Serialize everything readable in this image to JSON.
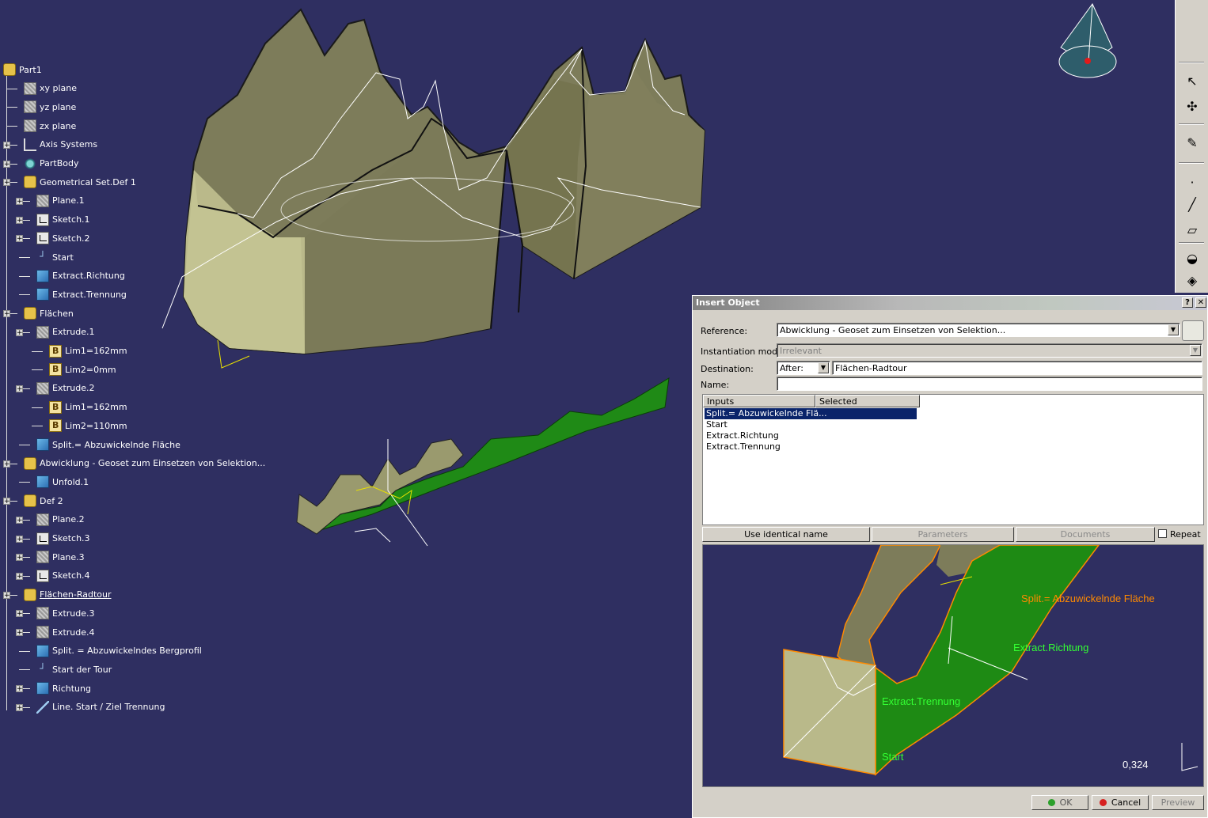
{
  "tree": [
    {
      "label": "Part1",
      "icon": "part-icon"
    },
    {
      "label": "xy plane",
      "icon": "plane-icon"
    },
    {
      "label": "yz plane",
      "icon": "plane-icon"
    },
    {
      "label": "zx plane",
      "icon": "plane-icon"
    },
    {
      "label": "Axis Systems",
      "icon": "axis-icon"
    },
    {
      "label": "PartBody",
      "icon": "body-icon"
    },
    {
      "label": "Geometrical Set.Def 1",
      "icon": "geoset-icon"
    },
    {
      "label": "Plane.1",
      "icon": "plane-icon"
    },
    {
      "label": "Sketch.1",
      "icon": "sketch-icon"
    },
    {
      "label": "Sketch.2",
      "icon": "sketch-icon"
    },
    {
      "label": "Start",
      "icon": "point-icon"
    },
    {
      "label": "Extract.Richtung",
      "icon": "surface-icon"
    },
    {
      "label": "Extract.Trennung",
      "icon": "surface-icon"
    },
    {
      "label": "Flächen",
      "icon": "geoset-icon"
    },
    {
      "label": "Extrude.1",
      "icon": "plane-icon"
    },
    {
      "label": "Lim1=162mm",
      "icon": "limit-icon"
    },
    {
      "label": "Lim2=0mm",
      "icon": "limit-icon"
    },
    {
      "label": "Extrude.2",
      "icon": "plane-icon"
    },
    {
      "label": "Lim1=162mm",
      "icon": "limit-icon"
    },
    {
      "label": "Lim2=110mm",
      "icon": "limit-icon"
    },
    {
      "label": "Split.= Abzuwickelnde Fläche",
      "icon": "surface-icon"
    },
    {
      "label": "Abwicklung - Geoset zum Einsetzen von Selektion...",
      "icon": "geoset-icon"
    },
    {
      "label": "Unfold.1",
      "icon": "surface-icon"
    },
    {
      "label": "Def 2",
      "icon": "geoset-icon"
    },
    {
      "label": "Plane.2",
      "icon": "plane-icon"
    },
    {
      "label": "Sketch.3",
      "icon": "sketch-icon"
    },
    {
      "label": "Plane.3",
      "icon": "plane-icon"
    },
    {
      "label": "Sketch.4",
      "icon": "sketch-icon"
    },
    {
      "label": "Flächen-Radtour",
      "icon": "geoset-icon"
    },
    {
      "label": "Extrude.3",
      "icon": "plane-icon"
    },
    {
      "label": "Extrude.4",
      "icon": "plane-icon"
    },
    {
      "label": "Split. = Abzuwickelndes Bergprofil",
      "icon": "surface-icon"
    },
    {
      "label": "Start der Tour",
      "icon": "point-icon"
    },
    {
      "label": "Richtung",
      "icon": "surface-icon"
    },
    {
      "label": "Line. Start / Ziel Trennung",
      "icon": "line-icon"
    }
  ],
  "dialog": {
    "title": "Insert Object",
    "help": "?",
    "close": "✕",
    "reference_label": "Reference:",
    "reference_value": "Abwicklung - Geoset zum Einsetzen von Selektion...",
    "instantiation_label": "Instantiation mode:",
    "instantiation_value": "Irrelevant",
    "destination_label": "Destination:",
    "destination_mode": "After:",
    "destination_value": "Flächen-Radtour",
    "name_label": "Name:",
    "name_value": "",
    "col_inputs": "Inputs",
    "col_selected": "Selected",
    "inputs": [
      "Split.= Abzuwickelnde Flä...",
      "Start",
      "Extract.Richtung",
      "Extract.Trennung"
    ],
    "use_identical_name": "Use identical name",
    "parameters": "Parameters",
    "documents": "Documents",
    "repeat": "Repeat",
    "ok": "OK",
    "cancel": "Cancel",
    "preview_btn": "Preview",
    "preview_labels": {
      "split": "Split.= Abzuwickelnde Fläche",
      "richtung": "Extract.Richtung",
      "trennung": "Extract.Trennung",
      "start": "Start",
      "scale": "0,324"
    }
  },
  "colors": {
    "background": "#2f2f61",
    "surface": "#8a8a62",
    "green_surface": "#1a8a12",
    "selection": "#0a246a"
  }
}
